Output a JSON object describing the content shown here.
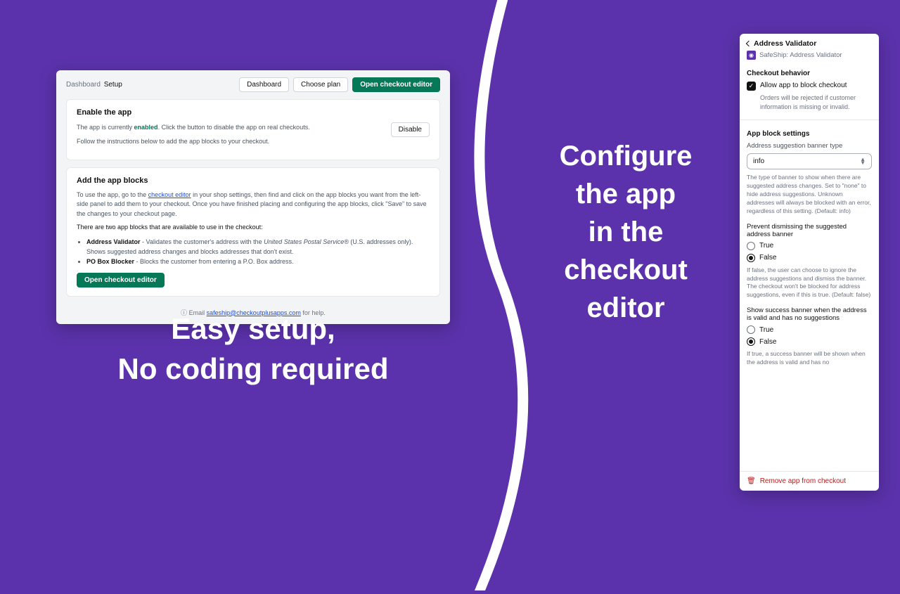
{
  "captions": {
    "left_line1": "Easy setup,",
    "left_line2": "No coding required",
    "right_line1": "Configure",
    "right_line2": "the app",
    "right_line3": "in the",
    "right_line4": "checkout",
    "right_line5": "editor"
  },
  "dash": {
    "crumb1": "Dashboard",
    "crumb2": "Setup",
    "btn_dashboard": "Dashboard",
    "btn_choose_plan": "Choose plan",
    "btn_open_editor": "Open checkout editor",
    "enable": {
      "title": "Enable the app",
      "status_pre": "The app is currently ",
      "status_word": "enabled",
      "status_post": ". Click the button to disable the app on real checkouts.",
      "btn_disable": "Disable",
      "follow": "Follow the instructions below to add the app blocks to your checkout."
    },
    "add": {
      "title": "Add the app blocks",
      "p1a": "To use the app, go to the ",
      "p1link": "checkout editor",
      "p1b": " in your shop settings, then find and click on the app blocks you want from the left-side panel to add them to your checkout. Once you have finished placing and configuring the app blocks, click \"Save\" to save the changes to your checkout page.",
      "p2": "There are two app blocks that are available to use in the checkout:",
      "li1_name": "Address Validator",
      "li1_desc_a": " - Validates the customer's address with the ",
      "li1_desc_i": "United States Postal Service®",
      "li1_desc_b": " (U.S. addresses only). Shows suggested address changes and blocks addresses that don't exist.",
      "li2_name": "PO Box Blocker",
      "li2_desc": " - Blocks the customer from entering a P.O. Box address.",
      "btn": "Open checkout editor"
    },
    "footer": {
      "pre": "Email ",
      "email": "safeship@checkoutplusapps.com",
      "post": " for help."
    }
  },
  "config": {
    "back_label": "Address Validator",
    "app_name": "SafeShip: Address Validator",
    "behavior": {
      "title": "Checkout behavior",
      "chk_label": "Allow app to block checkout",
      "chk_help": "Orders will be rejected if customer information is missing or invalid."
    },
    "settings": {
      "title": "App block settings",
      "banner_label": "Address suggestion banner type",
      "banner_value": "info",
      "banner_desc": "The type of banner to show when there are suggested address changes. Set to \"none\" to hide address suggestions. Unknown addresses will always be blocked with an error, regardless of this setting. (Default: info)",
      "dismiss_label": "Prevent dismissing the suggested address banner",
      "true": "True",
      "false": "False",
      "dismiss_desc": "If false, the user can choose to ignore the address suggestions and dismiss the banner. The checkout won't be blocked for address suggestions, even if this is true. (Default: false)",
      "success_label": "Show success banner when the address is valid and has no suggestions",
      "success_desc": "If true, a success banner will be shown when the address is valid and has no"
    },
    "remove": "Remove app from checkout"
  }
}
